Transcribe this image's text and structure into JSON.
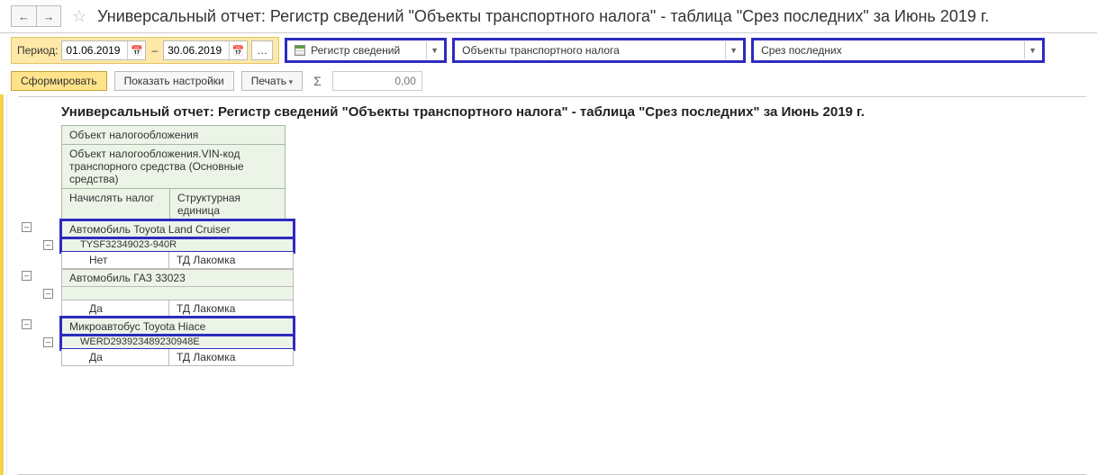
{
  "title": "Универсальный отчет: Регистр сведений \"Объекты транспортного налога\" - таблица \"Срез последних\" за Июнь 2019 г.",
  "period": {
    "label": "Период:",
    "from": "01.06.2019",
    "to": "30.06.2019",
    "dash": "–"
  },
  "combos": {
    "registry": "Регистр сведений",
    "object": "Объекты транспортного налога",
    "slice": "Срез последних"
  },
  "toolbar": {
    "generate": "Сформировать",
    "settings": "Показать настройки",
    "print": "Печать",
    "sum": "0,00"
  },
  "report": {
    "title": "Универсальный отчет: Регистр сведений \"Объекты транспортного налога\" - таблица \"Срез последних\" за Июнь 2019 г.",
    "headers": {
      "h1": "Объект налогообложения",
      "h2": "Объект налогообложения.VIN-код транспорного средства (Основные средства)",
      "h3a": "Начислять налог",
      "h3b": "Структурная единица"
    },
    "groups": [
      {
        "name": "Автомобиль Toyota Land Cruiser",
        "vin": "TYSF32349023-940R",
        "tax": "Нет",
        "unit": "ТД Лакомка",
        "highlight": true
      },
      {
        "name": "Автомобиль ГАЗ 33023",
        "vin": "",
        "tax": "Да",
        "unit": "ТД Лакомка",
        "highlight": false
      },
      {
        "name": "Микроавтобус Toyota Hiace",
        "vin": "WERD293923489230948E",
        "tax": "Да",
        "unit": "ТД Лакомка",
        "highlight": true
      }
    ]
  }
}
